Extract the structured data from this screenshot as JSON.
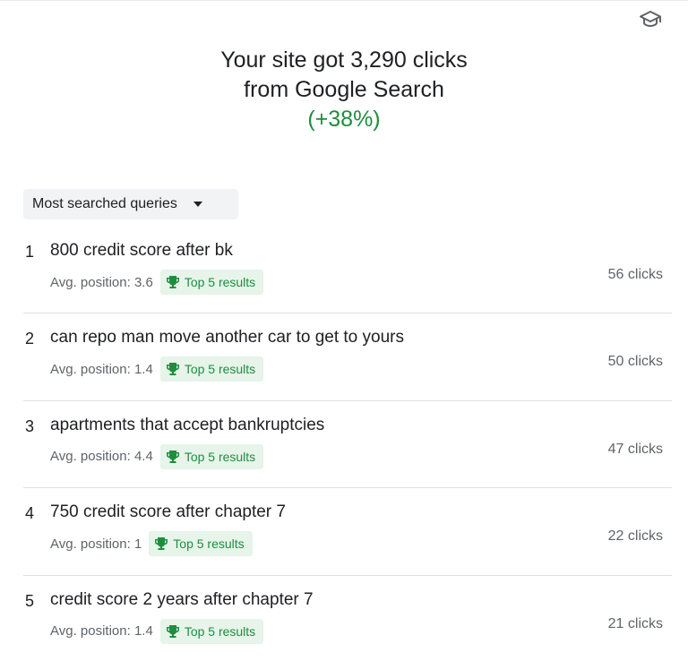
{
  "header": {
    "icon": "school-icon",
    "headline_line1": "Your site got 3,290 clicks",
    "headline_line2": "from Google Search",
    "delta": "(+38%)"
  },
  "colors": {
    "positive": "#1e8e3e",
    "badge_bg": "#e6f4ea",
    "dropdown_bg": "#f1f3f4"
  },
  "filter": {
    "selected": "Most searched queries",
    "icon": "arrow-drop-down-icon"
  },
  "queries": [
    {
      "rank": "1",
      "query": "800 credit score after bk",
      "position": "Avg. position: 3.6",
      "badge": "Top 5 results",
      "clicks": "56 clicks"
    },
    {
      "rank": "2",
      "query": "can repo man move another car to get to yours",
      "position": "Avg. position: 1.4",
      "badge": "Top 5 results",
      "clicks": "50 clicks"
    },
    {
      "rank": "3",
      "query": "apartments that accept bankruptcies",
      "position": "Avg. position: 4.4",
      "badge": "Top 5 results",
      "clicks": "47 clicks"
    },
    {
      "rank": "4",
      "query": "750 credit score after chapter 7",
      "position": "Avg. position: 1",
      "badge": "Top 5 results",
      "clicks": "22 clicks"
    },
    {
      "rank": "5",
      "query": "credit score 2 years after chapter 7",
      "position": "Avg. position: 1.4",
      "badge": "Top 5 results",
      "clicks": "21 clicks"
    }
  ]
}
